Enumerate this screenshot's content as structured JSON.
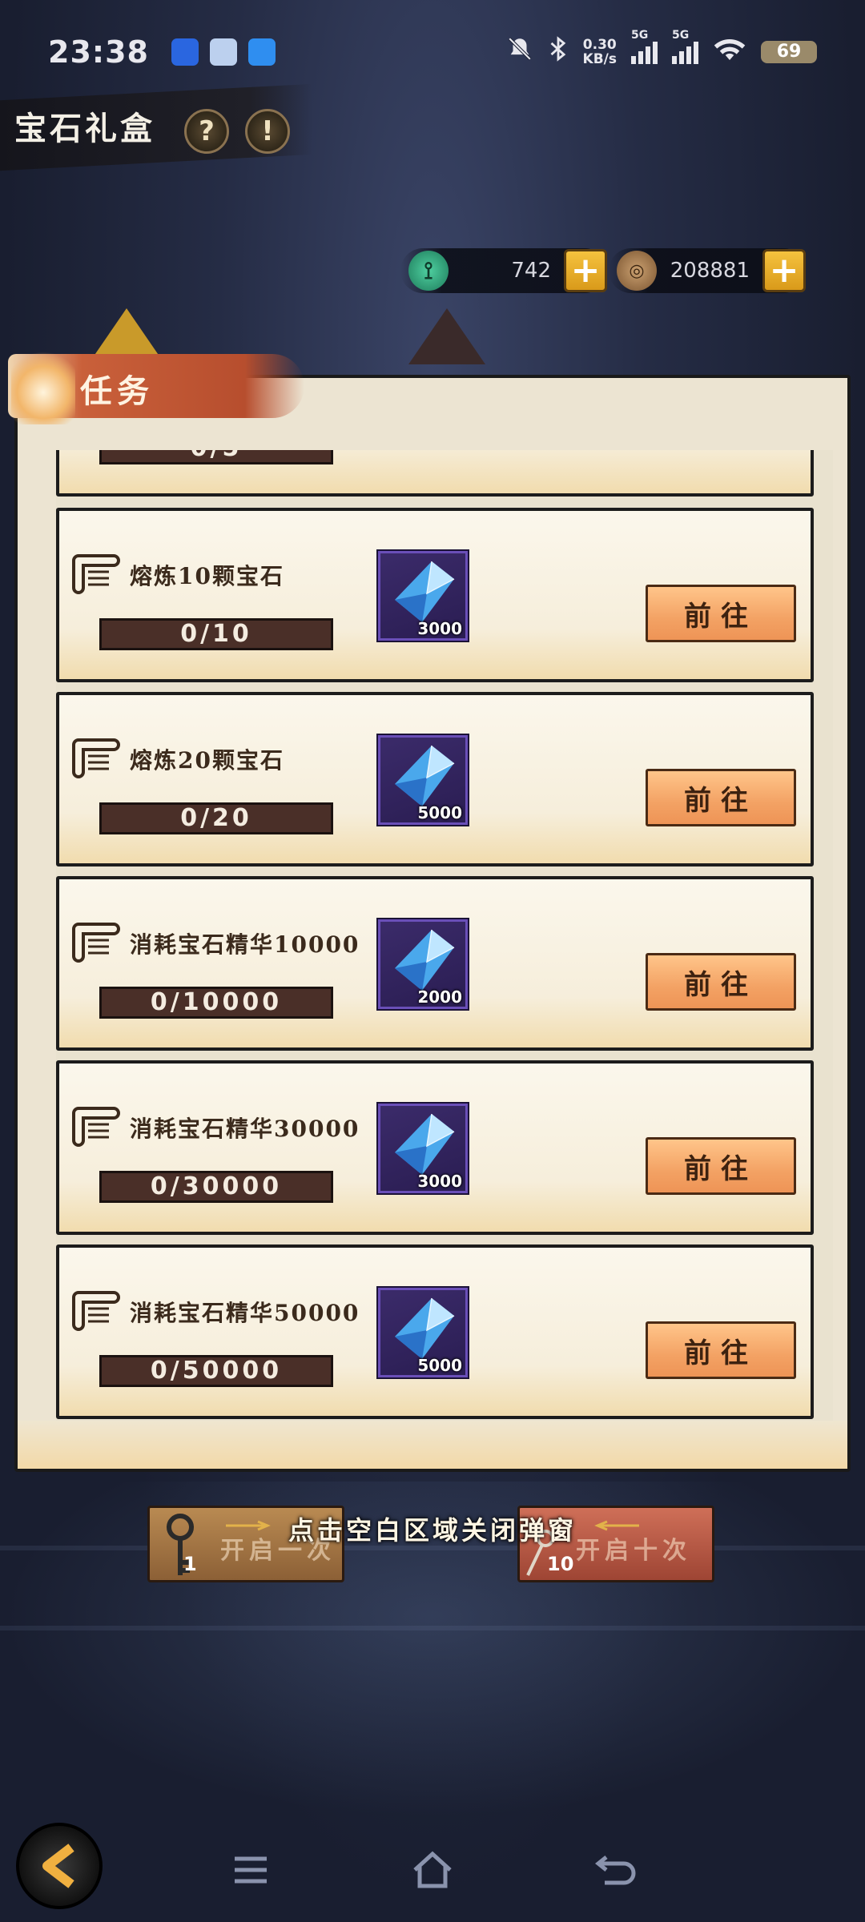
{
  "status_bar": {
    "time": "23:38",
    "net_speed_value": "0.30",
    "net_speed_unit": "KB/s",
    "signal_1_label": "5G",
    "signal_2_label": "5G",
    "battery": "69"
  },
  "header": {
    "title": "宝石礼盒",
    "help_icon": "?",
    "info_icon": "!"
  },
  "currency": {
    "jade_value": "742",
    "coin_value": "208881"
  },
  "panel": {
    "tab_label": "任务",
    "partial_top_progress": "0/5",
    "tasks": [
      {
        "title": "熔炼10颗宝石",
        "progress": "0/10",
        "reward_qty": "3000",
        "button": "前往"
      },
      {
        "title": "熔炼20颗宝石",
        "progress": "0/20",
        "reward_qty": "5000",
        "button": "前往"
      },
      {
        "title": "消耗宝石精华10000",
        "progress": "0/10000",
        "reward_qty": "2000",
        "button": "前往"
      },
      {
        "title": "消耗宝石精华30000",
        "progress": "0/30000",
        "reward_qty": "3000",
        "button": "前往"
      },
      {
        "title": "消耗宝石精华50000",
        "progress": "0/50000",
        "reward_qty": "5000",
        "button": "前往"
      }
    ]
  },
  "bottom": {
    "open_once_label": "开启一次",
    "open_once_keys": "1",
    "open_ten_label": "开启十次",
    "open_ten_keys": "10",
    "close_hint": "点击空白区域关闭弹窗"
  },
  "colors": {
    "go_button": "#f3a264",
    "progress_bar": "#4a2f28",
    "reward_frame": "#6a4fb8",
    "tab": "#b74e2e"
  }
}
